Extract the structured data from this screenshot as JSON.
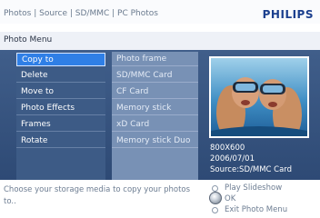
{
  "header": {
    "breadcrumb": "Photos | Source | SD/MMC | PC Photos",
    "brand": "PHILIPS"
  },
  "menu_bar": {
    "title": "Photo Menu"
  },
  "menu": {
    "items": [
      "Copy to",
      "Delete",
      "Move to",
      "Photo Effects",
      "Frames",
      "Rotate"
    ],
    "selected": "Copy to"
  },
  "submenu": {
    "items": [
      "Photo frame",
      "SD/MMC Card",
      "CF Card",
      "Memory stick",
      "xD Card",
      "Memory stick Duo"
    ]
  },
  "photo_info": {
    "resolution": "800X600",
    "date": "2006/07/01",
    "source": "Source:SD/MMC Card"
  },
  "footer": {
    "help_text": "Choose your storage media to copy your photos to..",
    "options": [
      "Play Slideshow",
      "OK",
      "Exit Photo Menu"
    ]
  }
}
